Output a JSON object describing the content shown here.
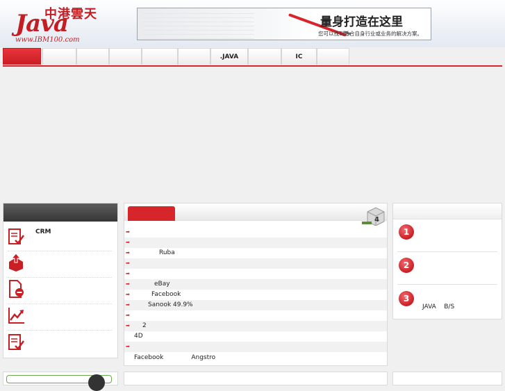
{
  "logo": {
    "title": "中港雲天",
    "mark": "Java",
    "url": "www.IBM100.com"
  },
  "banner": {
    "headline": "量身打造在这里",
    "subline": "您可以找到适合自身行业或业务的解决方案。"
  },
  "nav": {
    "items": [
      "",
      "",
      "",
      "",
      "",
      "",
      ".JAVA",
      "",
      "IC",
      ""
    ]
  },
  "left_panel": {
    "items": [
      {
        "label": "CRM",
        "icon": "document-check-icon"
      },
      {
        "label": "",
        "icon": "upload-box-icon"
      },
      {
        "label": "",
        "icon": "document-minus-icon"
      },
      {
        "label": "",
        "icon": "chart-up-icon"
      },
      {
        "label": "",
        "icon": "document-check-icon"
      }
    ]
  },
  "news": {
    "rows": [
      "",
      "",
      "Ruba",
      "",
      "",
      "eBay",
      "Facebook",
      "Sanook 49.9%",
      "",
      "2",
      "4D",
      "",
      "Facebook              Angstro"
    ]
  },
  "rankings": {
    "items": [
      {
        "number": "1",
        "text": ""
      },
      {
        "number": "2",
        "text": ""
      },
      {
        "number": "3",
        "text": "JAVA    B/S"
      }
    ]
  },
  "colors": {
    "accent": "#d7262b",
    "dark_header": "#3e3e3e"
  }
}
